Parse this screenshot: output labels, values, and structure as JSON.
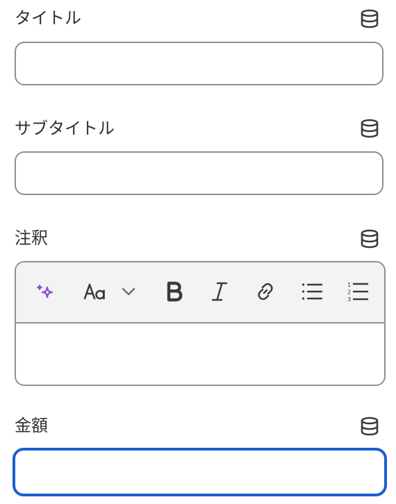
{
  "fields": {
    "title": {
      "label": "タイトル",
      "value": ""
    },
    "subtitle": {
      "label": "サブタイトル",
      "value": ""
    },
    "note": {
      "label": "注釈",
      "value": ""
    },
    "amount": {
      "label": "金額",
      "value": ""
    }
  },
  "editor_toolbar": {
    "items": [
      {
        "icon": "sparkle-icon",
        "color": "#8a4fd8"
      },
      {
        "icon": "font-size-icon",
        "text": "Aa"
      },
      {
        "icon": "chevron-down-icon"
      },
      {
        "icon": "bold-icon"
      },
      {
        "icon": "italic-icon"
      },
      {
        "icon": "link-icon"
      },
      {
        "icon": "bullet-list-icon"
      },
      {
        "icon": "numbered-list-icon"
      }
    ]
  },
  "colors": {
    "focus": "#1d5fd0",
    "border": "#8e8e8e",
    "toolbar_bg": "#f3f3f3",
    "text": "#303030"
  }
}
